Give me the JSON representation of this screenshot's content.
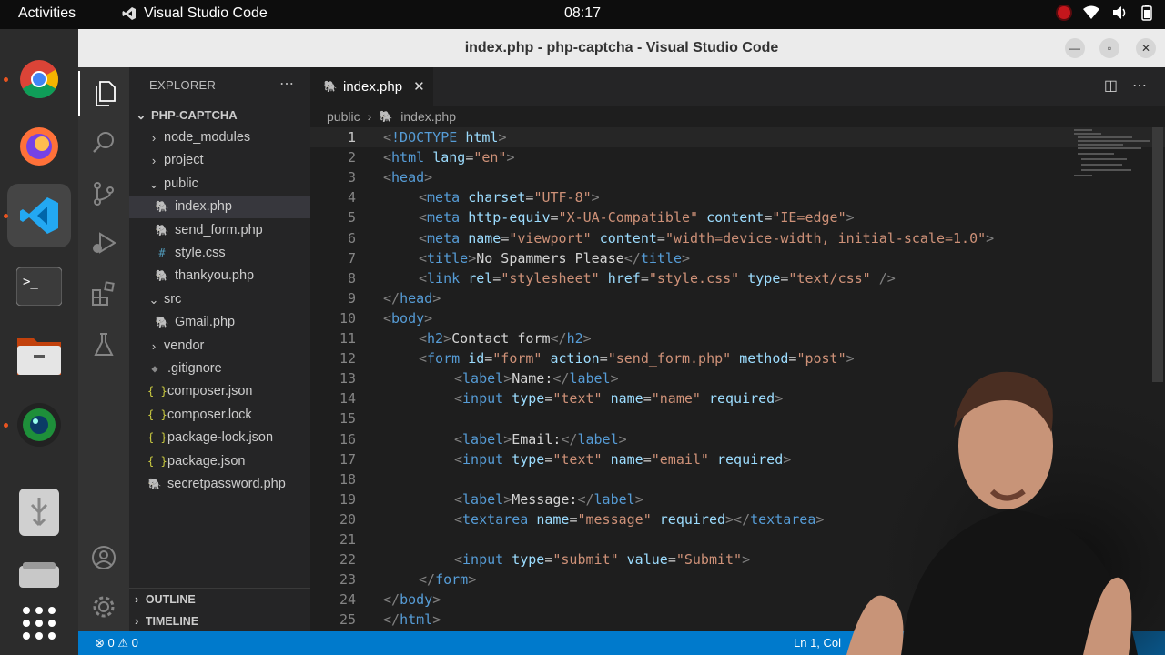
{
  "topbar": {
    "activities": "Activities",
    "app_name": "Visual Studio Code",
    "clock": "08:17"
  },
  "dock": {
    "items": [
      "chrome-icon",
      "firefox-icon",
      "vscode-icon",
      "terminal-icon",
      "files-icon",
      "webcam-icon",
      "usb-drive-icon",
      "drive-icon",
      "app-grid-icon"
    ]
  },
  "window": {
    "title": "index.php - php-captcha - Visual Studio Code",
    "colors": {
      "activity_bar": "#333333",
      "sidebar": "#252526",
      "editor": "#1e1e1e",
      "status_bar": "#007acc"
    }
  },
  "sidebar": {
    "header": "EXPLORER",
    "project": "PHP-CAPTCHA",
    "tree": [
      {
        "label": "node_modules",
        "type": "folder",
        "open": false,
        "indent": 1
      },
      {
        "label": "project",
        "type": "folder",
        "open": false,
        "indent": 1
      },
      {
        "label": "public",
        "type": "folder",
        "open": true,
        "indent": 1
      },
      {
        "label": "index.php",
        "type": "php",
        "indent": 2,
        "selected": true
      },
      {
        "label": "send_form.php",
        "type": "php",
        "indent": 2
      },
      {
        "label": "style.css",
        "type": "css",
        "indent": 2
      },
      {
        "label": "thankyou.php",
        "type": "php",
        "indent": 2
      },
      {
        "label": "src",
        "type": "folder",
        "open": true,
        "indent": 1
      },
      {
        "label": "Gmail.php",
        "type": "php",
        "indent": 2
      },
      {
        "label": "vendor",
        "type": "folder",
        "open": false,
        "indent": 1
      },
      {
        "label": ".gitignore",
        "type": "git",
        "indent": 1
      },
      {
        "label": "composer.json",
        "type": "json",
        "indent": 1
      },
      {
        "label": "composer.lock",
        "type": "json",
        "indent": 1
      },
      {
        "label": "package-lock.json",
        "type": "json",
        "indent": 1
      },
      {
        "label": "package.json",
        "type": "json",
        "indent": 1
      },
      {
        "label": "secretpassword.php",
        "type": "php",
        "indent": 1
      }
    ],
    "outline": "OUTLINE",
    "timeline": "TIMELINE"
  },
  "editor": {
    "tab": "index.php",
    "breadcrumb": [
      "public",
      "index.php"
    ],
    "current_line": 1,
    "lines": [
      {
        "n": "1",
        "indent": 0,
        "tokens": [
          [
            "bracket",
            "<"
          ],
          [
            "tag",
            "!DOCTYPE"
          ],
          [
            "text",
            " "
          ],
          [
            "attr",
            "html"
          ],
          [
            "bracket",
            ">"
          ]
        ]
      },
      {
        "n": "2",
        "indent": 0,
        "tokens": [
          [
            "bracket",
            "<"
          ],
          [
            "tag",
            "html"
          ],
          [
            "text",
            " "
          ],
          [
            "attr",
            "lang"
          ],
          [
            "text",
            "="
          ],
          [
            "val",
            "\"en\""
          ],
          [
            "bracket",
            ">"
          ]
        ]
      },
      {
        "n": "3",
        "indent": 0,
        "tokens": [
          [
            "bracket",
            "<"
          ],
          [
            "tag",
            "head"
          ],
          [
            "bracket",
            ">"
          ]
        ]
      },
      {
        "n": "4",
        "indent": 1,
        "tokens": [
          [
            "bracket",
            "<"
          ],
          [
            "tag",
            "meta"
          ],
          [
            "text",
            " "
          ],
          [
            "attr",
            "charset"
          ],
          [
            "text",
            "="
          ],
          [
            "val",
            "\"UTF-8\""
          ],
          [
            "bracket",
            ">"
          ]
        ]
      },
      {
        "n": "5",
        "indent": 1,
        "tokens": [
          [
            "bracket",
            "<"
          ],
          [
            "tag",
            "meta"
          ],
          [
            "text",
            " "
          ],
          [
            "attr",
            "http-equiv"
          ],
          [
            "text",
            "="
          ],
          [
            "val",
            "\"X-UA-Compatible\""
          ],
          [
            "text",
            " "
          ],
          [
            "attr",
            "content"
          ],
          [
            "text",
            "="
          ],
          [
            "val",
            "\"IE=edge\""
          ],
          [
            "bracket",
            ">"
          ]
        ]
      },
      {
        "n": "6",
        "indent": 1,
        "tokens": [
          [
            "bracket",
            "<"
          ],
          [
            "tag",
            "meta"
          ],
          [
            "text",
            " "
          ],
          [
            "attr",
            "name"
          ],
          [
            "text",
            "="
          ],
          [
            "val",
            "\"viewport\""
          ],
          [
            "text",
            " "
          ],
          [
            "attr",
            "content"
          ],
          [
            "text",
            "="
          ],
          [
            "val",
            "\"width=device-width, initial-scale=1.0\""
          ],
          [
            "bracket",
            ">"
          ]
        ]
      },
      {
        "n": "7",
        "indent": 1,
        "tokens": [
          [
            "bracket",
            "<"
          ],
          [
            "tag",
            "title"
          ],
          [
            "bracket",
            ">"
          ],
          [
            "text",
            "No Spammers Please"
          ],
          [
            "bracket",
            "</"
          ],
          [
            "tag",
            "title"
          ],
          [
            "bracket",
            ">"
          ]
        ]
      },
      {
        "n": "8",
        "indent": 1,
        "tokens": [
          [
            "bracket",
            "<"
          ],
          [
            "tag",
            "link"
          ],
          [
            "text",
            " "
          ],
          [
            "attr",
            "rel"
          ],
          [
            "text",
            "="
          ],
          [
            "val",
            "\"stylesheet\""
          ],
          [
            "text",
            " "
          ],
          [
            "attr",
            "href"
          ],
          [
            "text",
            "="
          ],
          [
            "val",
            "\"style.css\""
          ],
          [
            "text",
            " "
          ],
          [
            "attr",
            "type"
          ],
          [
            "text",
            "="
          ],
          [
            "val",
            "\"text/css\""
          ],
          [
            "text",
            " "
          ],
          [
            "bracket",
            "/>"
          ]
        ]
      },
      {
        "n": "9",
        "indent": 0,
        "tokens": [
          [
            "bracket",
            "</"
          ],
          [
            "tag",
            "head"
          ],
          [
            "bracket",
            ">"
          ]
        ]
      },
      {
        "n": "10",
        "indent": 0,
        "tokens": [
          [
            "bracket",
            "<"
          ],
          [
            "tag",
            "body"
          ],
          [
            "bracket",
            ">"
          ]
        ]
      },
      {
        "n": "11",
        "indent": 1,
        "tokens": [
          [
            "bracket",
            "<"
          ],
          [
            "tag",
            "h2"
          ],
          [
            "bracket",
            ">"
          ],
          [
            "text",
            "Contact form"
          ],
          [
            "bracket",
            "</"
          ],
          [
            "tag",
            "h2"
          ],
          [
            "bracket",
            ">"
          ]
        ]
      },
      {
        "n": "12",
        "indent": 1,
        "tokens": [
          [
            "bracket",
            "<"
          ],
          [
            "tag",
            "form"
          ],
          [
            "text",
            " "
          ],
          [
            "attr",
            "id"
          ],
          [
            "text",
            "="
          ],
          [
            "val",
            "\"form\""
          ],
          [
            "text",
            " "
          ],
          [
            "attr",
            "action"
          ],
          [
            "text",
            "="
          ],
          [
            "val",
            "\"send_form.php\""
          ],
          [
            "text",
            " "
          ],
          [
            "attr",
            "method"
          ],
          [
            "text",
            "="
          ],
          [
            "val",
            "\"post\""
          ],
          [
            "bracket",
            ">"
          ]
        ]
      },
      {
        "n": "13",
        "indent": 2,
        "tokens": [
          [
            "bracket",
            "<"
          ],
          [
            "tag",
            "label"
          ],
          [
            "bracket",
            ">"
          ],
          [
            "text",
            "Name:"
          ],
          [
            "bracket",
            "</"
          ],
          [
            "tag",
            "label"
          ],
          [
            "bracket",
            ">"
          ]
        ]
      },
      {
        "n": "14",
        "indent": 2,
        "tokens": [
          [
            "bracket",
            "<"
          ],
          [
            "tag",
            "input"
          ],
          [
            "text",
            " "
          ],
          [
            "attr",
            "type"
          ],
          [
            "text",
            "="
          ],
          [
            "val",
            "\"text\""
          ],
          [
            "text",
            " "
          ],
          [
            "attr",
            "name"
          ],
          [
            "text",
            "="
          ],
          [
            "val",
            "\"name\""
          ],
          [
            "text",
            " "
          ],
          [
            "attr",
            "required"
          ],
          [
            "bracket",
            ">"
          ]
        ]
      },
      {
        "n": "15",
        "indent": 0,
        "tokens": []
      },
      {
        "n": "16",
        "indent": 2,
        "tokens": [
          [
            "bracket",
            "<"
          ],
          [
            "tag",
            "label"
          ],
          [
            "bracket",
            ">"
          ],
          [
            "text",
            "Email:"
          ],
          [
            "bracket",
            "</"
          ],
          [
            "tag",
            "label"
          ],
          [
            "bracket",
            ">"
          ]
        ]
      },
      {
        "n": "17",
        "indent": 2,
        "tokens": [
          [
            "bracket",
            "<"
          ],
          [
            "tag",
            "input"
          ],
          [
            "text",
            " "
          ],
          [
            "attr",
            "type"
          ],
          [
            "text",
            "="
          ],
          [
            "val",
            "\"text\""
          ],
          [
            "text",
            " "
          ],
          [
            "attr",
            "name"
          ],
          [
            "text",
            "="
          ],
          [
            "val",
            "\"email\""
          ],
          [
            "text",
            " "
          ],
          [
            "attr",
            "required"
          ],
          [
            "bracket",
            ">"
          ]
        ]
      },
      {
        "n": "18",
        "indent": 0,
        "tokens": []
      },
      {
        "n": "19",
        "indent": 2,
        "tokens": [
          [
            "bracket",
            "<"
          ],
          [
            "tag",
            "label"
          ],
          [
            "bracket",
            ">"
          ],
          [
            "text",
            "Message:"
          ],
          [
            "bracket",
            "</"
          ],
          [
            "tag",
            "label"
          ],
          [
            "bracket",
            ">"
          ]
        ]
      },
      {
        "n": "20",
        "indent": 2,
        "tokens": [
          [
            "bracket",
            "<"
          ],
          [
            "tag",
            "textarea"
          ],
          [
            "text",
            " "
          ],
          [
            "attr",
            "name"
          ],
          [
            "text",
            "="
          ],
          [
            "val",
            "\"message\""
          ],
          [
            "text",
            " "
          ],
          [
            "attr",
            "required"
          ],
          [
            "bracket",
            "></"
          ],
          [
            "tag",
            "textarea"
          ],
          [
            "bracket",
            ">"
          ]
        ]
      },
      {
        "n": "21",
        "indent": 0,
        "tokens": []
      },
      {
        "n": "22",
        "indent": 2,
        "tokens": [
          [
            "bracket",
            "<"
          ],
          [
            "tag",
            "input"
          ],
          [
            "text",
            " "
          ],
          [
            "attr",
            "type"
          ],
          [
            "text",
            "="
          ],
          [
            "val",
            "\"submit\""
          ],
          [
            "text",
            " "
          ],
          [
            "attr",
            "value"
          ],
          [
            "text",
            "="
          ],
          [
            "val",
            "\"Submit\""
          ],
          [
            "bracket",
            ">"
          ]
        ]
      },
      {
        "n": "23",
        "indent": 1,
        "tokens": [
          [
            "bracket",
            "</"
          ],
          [
            "tag",
            "form"
          ],
          [
            "bracket",
            ">"
          ]
        ]
      },
      {
        "n": "24",
        "indent": 0,
        "tokens": [
          [
            "bracket",
            "</"
          ],
          [
            "tag",
            "body"
          ],
          [
            "bracket",
            ">"
          ]
        ]
      },
      {
        "n": "25",
        "indent": 0,
        "tokens": [
          [
            "bracket",
            "</"
          ],
          [
            "tag",
            "html"
          ],
          [
            "bracket",
            ">"
          ]
        ]
      }
    ]
  },
  "statusbar": {
    "problems": "⊗ 0 ⚠ 0",
    "position": "Ln 1, Col"
  }
}
